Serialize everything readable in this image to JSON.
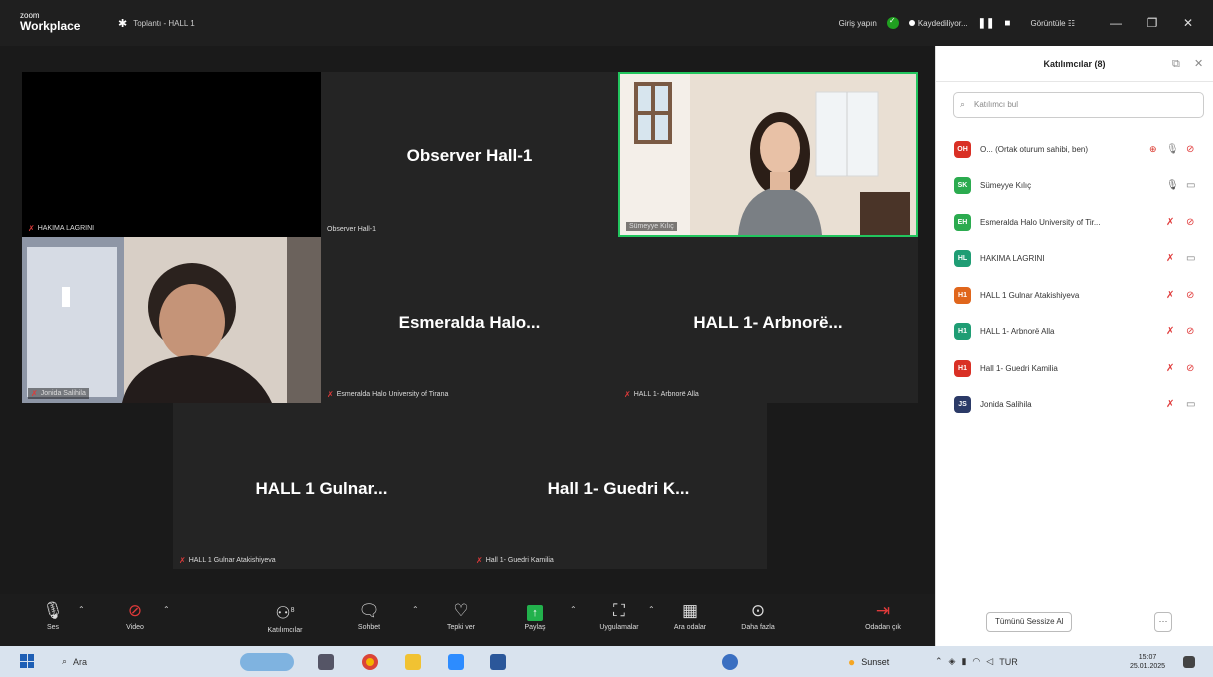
{
  "app": {
    "logo_line1": "zoom",
    "logo_line2": "Workplace",
    "meeting_title": "Toplantı - HALL 1",
    "signin": "Giriş yapın",
    "recording": "Kaydediliyor...",
    "view": "Görüntüle"
  },
  "tiles": [
    {
      "id": "hakima",
      "label": "HAKIMA LAGRINI",
      "center": ""
    },
    {
      "id": "observer",
      "label": "Observer Hall-1",
      "center": "Observer Hall-1"
    },
    {
      "id": "sumeyye",
      "label": "Sümeyye Kılıç",
      "center": ""
    },
    {
      "id": "jonida",
      "label": "Jonida Salihila",
      "center": ""
    },
    {
      "id": "esmeralda",
      "label": "Esmeralda Halo University of Tirana",
      "center": "Esmeralda  Halo..."
    },
    {
      "id": "arbnore",
      "label": "HALL 1- Arbnorë Alla",
      "center": "HALL 1- Arbnorë..."
    },
    {
      "id": "gulnar",
      "label": "HALL 1  Gulnar Atakishiyeva",
      "center": "HALL 1  Gulnar..."
    },
    {
      "id": "guedri",
      "label": "Hall 1- Guedri Kamilia",
      "center": "Hall 1- Guedri K..."
    }
  ],
  "toolbar": {
    "audio": "Ses",
    "video": "Video",
    "participants": "Katılımcılar",
    "participants_count": "8",
    "chat": "Sohbet",
    "react": "Tepki ver",
    "share": "Paylaş",
    "apps": "Uygulamalar",
    "breakout": "Ara odalar",
    "more": "Daha fazla",
    "leave": "Odadan çık"
  },
  "panel": {
    "title": "Katılımcılar (8)",
    "search_placeholder": "Katılımcı bul",
    "participants": [
      {
        "initials": "OH",
        "color": "#d93025",
        "name": "O... (Ortak oturum sahibi, ben)"
      },
      {
        "initials": "SK",
        "color": "#2bab4f",
        "name": "Sümeyye Kılıç"
      },
      {
        "initials": "EH",
        "color": "#2bab4f",
        "name": "Esmeralda Halo University of Tir..."
      },
      {
        "initials": "HL",
        "color": "#1f9d74",
        "name": "HAKIMA LAGRINI"
      },
      {
        "initials": "H1",
        "color": "#e0661c",
        "name": "HALL 1  Gulnar Atakishiyeva"
      },
      {
        "initials": "H1",
        "color": "#1f9d74",
        "name": "HALL 1- Arbnorë Alla"
      },
      {
        "initials": "H1",
        "color": "#d93025",
        "name": "Hall 1- Guedri Kamilia"
      },
      {
        "initials": "JS",
        "color": "#2b3a67",
        "name": "Jonida Salihila"
      }
    ],
    "mute_all": "Tümünü Sessize Al",
    "more": "···"
  },
  "taskbar": {
    "search": "Ara",
    "weather": "Sunset",
    "lang": "TUR",
    "time": "15:07",
    "date": "25.01.2025"
  }
}
